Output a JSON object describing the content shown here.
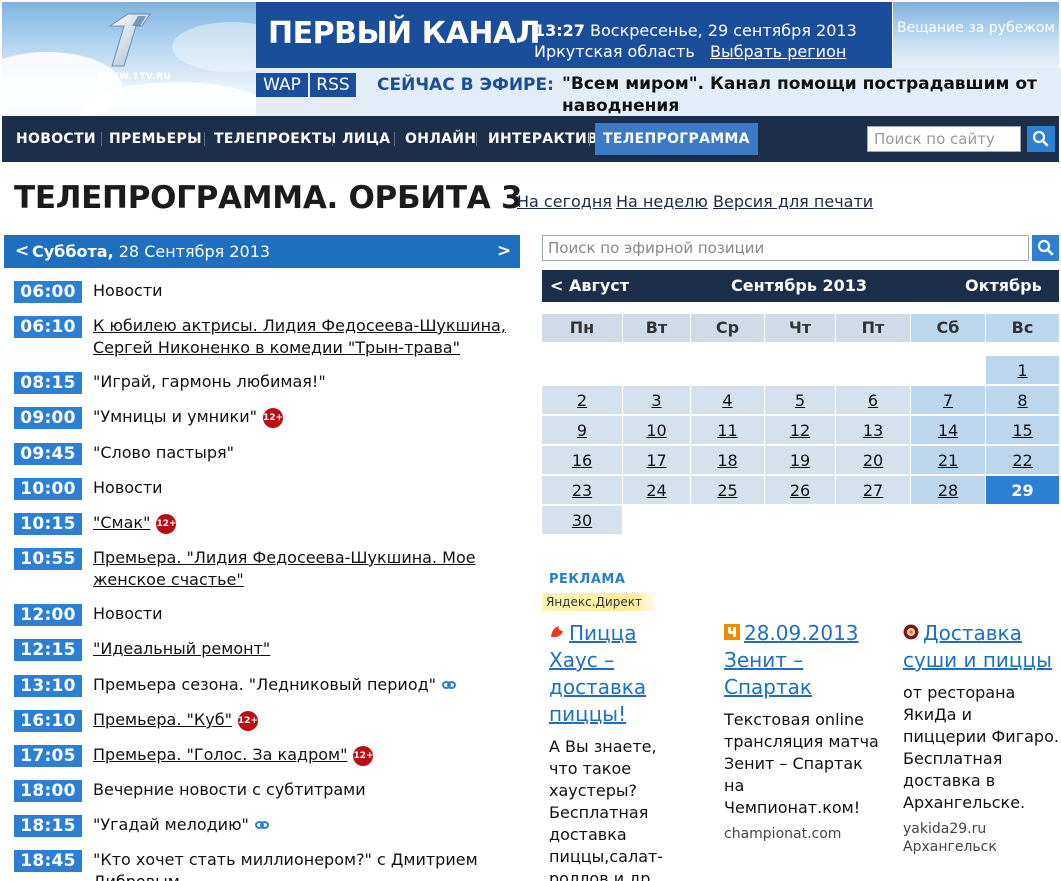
{
  "header": {
    "logo_url_text": "WWW.1TV.RU",
    "channel_title": "ПЕРВЫЙ КАНАЛ",
    "time": "13:27",
    "date": "Воскресенье, 29 сентября 2013",
    "region": "Иркутская область",
    "region_link": "Выбрать регион",
    "abroad": "Вещание за рубежом",
    "wap": "WAP",
    "rss": "RSS",
    "onair_label": "СЕЙЧАС В ЭФИРЕ:",
    "onair_text": "\"Всем миром\". Канал помощи пострадавшим от наводнения"
  },
  "nav": {
    "items": [
      "НОВОСТИ",
      "ПРЕМЬЕРЫ",
      "ТЕЛЕПРОЕКТЫ",
      "ЛИЦА",
      "ОНЛАЙН",
      "ИНТЕРАКТИВ",
      "ТЕЛЕПРОГРАММА"
    ],
    "active": "ТЕЛЕПРОГРАММА",
    "search_placeholder": "Поиск по сайту"
  },
  "page": {
    "title": "ТЕЛЕПРОГРАММА. ОРБИТА 3",
    "links": [
      "На сегодня",
      "На неделю",
      "Версия для печати"
    ]
  },
  "schedule": {
    "prev": "<",
    "next": ">",
    "day_name": "Суббота,",
    "day_date": " 28 Сентября 2013",
    "items": [
      {
        "time": "06:00",
        "title": "Новости"
      },
      {
        "time": "06:10",
        "title": "К юбилею актрисы. Лидия Федосеева-Шукшина, Сергей Никоненко в комедии \"Трын-трава\""
      },
      {
        "time": "08:15",
        "title": "\"Играй, гармонь любимая!\""
      },
      {
        "time": "09:00",
        "title": "\"Умницы и умники\"",
        "rating": "12+"
      },
      {
        "time": "09:45",
        "title": "\"Слово пастыря\""
      },
      {
        "time": "10:00",
        "title": "Новости"
      },
      {
        "time": "10:15",
        "title": "\"Смак\"",
        "rating": "12+"
      },
      {
        "time": "10:55",
        "title": "Премьера. \"Лидия Федосеева-Шукшина. Мое женское счастье\""
      },
      {
        "time": "12:00",
        "title": "Новости"
      },
      {
        "time": "12:15",
        "title": "\"Идеальный ремонт\""
      },
      {
        "time": "13:10",
        "title": "Премьера сезона. \"Ледниковый период\""
      },
      {
        "time": "16:10",
        "title": "Премьера. \"Куб\"",
        "rating": "12+"
      },
      {
        "time": "17:05",
        "title": "Премьера. \"Голос. За кадром\"",
        "rating": "12+"
      },
      {
        "time": "18:00",
        "title": "Вечерние новости с субтитрами"
      },
      {
        "time": "18:15",
        "title": "\"Угадай мелодию\""
      },
      {
        "time": "18:45",
        "title": "\"Кто хочет стать миллионером?\" с Дмитрием Дибровым"
      }
    ]
  },
  "search_position": {
    "placeholder": "Поиск по эфирной позиции"
  },
  "calendar": {
    "prev": "< Август",
    "month": "Сентябрь 2013",
    "next": "Октябрь >",
    "weekdays": [
      "Пн",
      "Вт",
      "Ср",
      "Чт",
      "Пт",
      "Сб",
      "Вс"
    ],
    "days": [
      "1",
      "2",
      "3",
      "4",
      "5",
      "6",
      "7",
      "8",
      "9",
      "10",
      "11",
      "12",
      "13",
      "14",
      "15",
      "16",
      "17",
      "18",
      "19",
      "20",
      "21",
      "22",
      "23",
      "24",
      "25",
      "26",
      "27",
      "28",
      "29",
      "30"
    ],
    "selected_day": "29"
  },
  "ads": {
    "label": "РЕКЛАМА",
    "provider": "Яндекс.Директ",
    "items": [
      {
        "title": "Пицца Хаус – доставка пиццы!",
        "text": "А Вы знаете, что такое хаустеры? Бесплатная доставка пиццы,салат-роллов и др.",
        "source": ""
      },
      {
        "title": "28.09.2013 Зенит – Спартак",
        "text": "Текстовая online трансляция матча Зенит – Спартак на Чемпионат.ком!",
        "source": "championat.com"
      },
      {
        "title": "Доставка суши и пиццы",
        "text": "от ресторана ЯкиДа и пиццерии Фигаро. Бесплатная доставка в Архангельске.",
        "source": "yakida29.ru",
        "source2": "Архангельск"
      }
    ]
  },
  "colors": {
    "brand_blue": "#1a4e9a",
    "nav_bg": "#1b2f4a",
    "time_badge": "#2c7fd3",
    "rating_badge": "#b80e14"
  }
}
